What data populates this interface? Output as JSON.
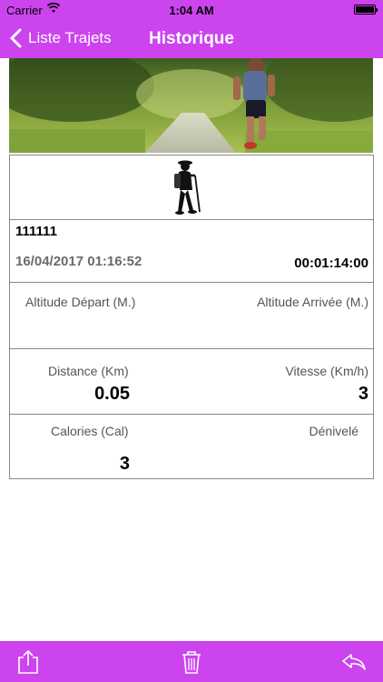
{
  "status_bar": {
    "carrier": "Carrier",
    "time": "1:04 AM",
    "battery_level": 1.0
  },
  "nav": {
    "back_label": "Liste Trajets",
    "title": "Historique"
  },
  "theme": {
    "accent": "#cc44ee"
  },
  "trip": {
    "activity_icon": "hiker-icon",
    "code": "111111",
    "datetime": "16/04/2017 01:16:52",
    "duration": "00:01:14:00",
    "altitude_start_label": "Altitude Départ (M.)",
    "altitude_end_label": "Altitude Arrivée (M.)",
    "distance_label": "Distance (Km)",
    "distance_value": "0.05",
    "speed_label": "Vitesse (Km/h)",
    "speed_value": "3",
    "calories_label": "Calories (Cal)",
    "calories_value": "3",
    "elevation_label": "Dénivelé"
  },
  "toolbar": {
    "icons": [
      "share-icon",
      "trash-icon",
      "reply-icon"
    ]
  }
}
